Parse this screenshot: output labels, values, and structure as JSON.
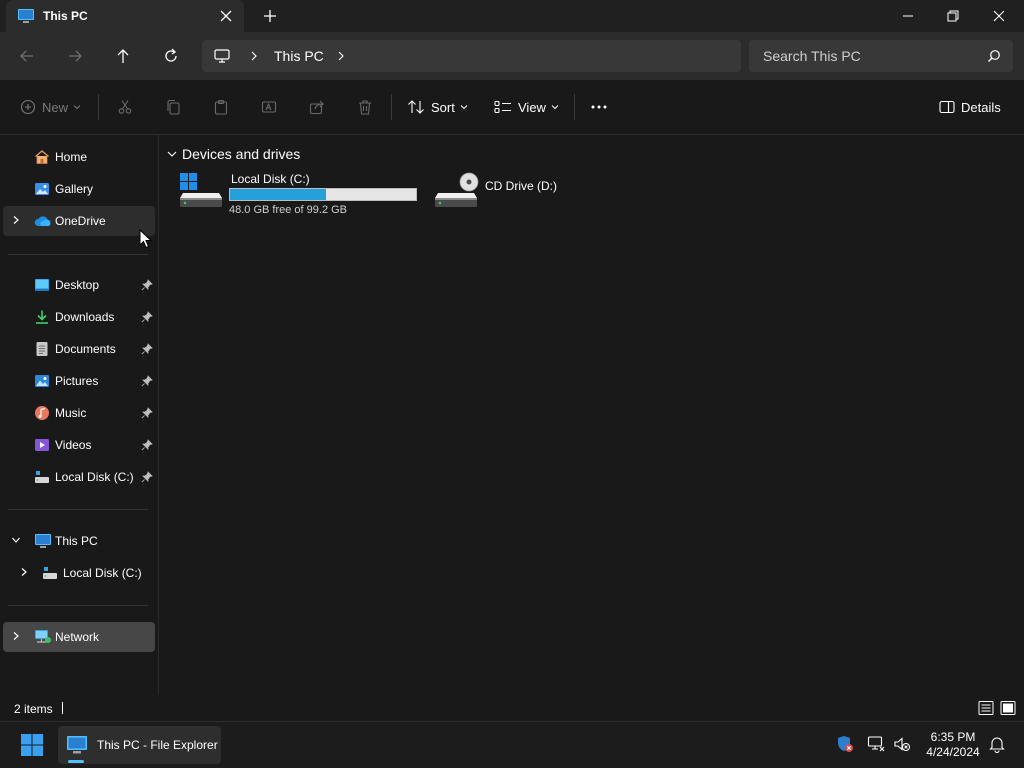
{
  "window": {
    "tab_title": "This PC",
    "icons": {
      "tab": "this-pc-icon",
      "close_tab": "close-icon",
      "new_tab": "plus-icon",
      "minimize": "minimize-icon",
      "maximize": "restore-icon",
      "close": "close-icon"
    }
  },
  "address_bar": {
    "breadcrumbs": [
      "This PC"
    ],
    "icons": {
      "root": "monitor-icon",
      "separator": "chevron-right-icon"
    },
    "nav": {
      "back": "arrow-left-icon",
      "forward": "arrow-right-icon",
      "up": "arrow-up-icon",
      "refresh": "refresh-icon"
    }
  },
  "search": {
    "placeholder": "Search This PC",
    "value": "",
    "icon": "search-icon"
  },
  "command_bar": {
    "new_label": "New",
    "sort_label": "Sort",
    "view_label": "View",
    "details_label": "Details",
    "disabled_actions": [
      "cut-icon",
      "copy-icon",
      "paste-icon",
      "rename-icon",
      "share-icon",
      "delete-icon"
    ],
    "more_icon": "more-icon"
  },
  "sidebar": {
    "quick": [
      {
        "label": "Home",
        "icon": "home-icon"
      },
      {
        "label": "Gallery",
        "icon": "gallery-icon"
      },
      {
        "label": "OneDrive",
        "icon": "onedrive-icon",
        "expandable": true,
        "state": "hover"
      }
    ],
    "pinned": [
      {
        "label": "Desktop",
        "icon": "desktop-icon"
      },
      {
        "label": "Downloads",
        "icon": "downloads-icon"
      },
      {
        "label": "Documents",
        "icon": "documents-icon"
      },
      {
        "label": "Pictures",
        "icon": "pictures-icon"
      },
      {
        "label": "Music",
        "icon": "music-icon"
      },
      {
        "label": "Videos",
        "icon": "videos-icon"
      },
      {
        "label": "Local Disk (C:)",
        "icon": "drive-icon"
      }
    ],
    "this_pc": {
      "label": "This PC",
      "icon": "this-pc-icon",
      "expanded": true
    },
    "this_pc_children": [
      {
        "label": "Local Disk (C:)",
        "icon": "drive-icon"
      }
    ],
    "network": {
      "label": "Network",
      "icon": "network-icon",
      "state": "selected"
    }
  },
  "content": {
    "group_title": "Devices and drives",
    "drives": [
      {
        "name": "Local Disk (C:)",
        "free_text": "48.0 GB free of 99.2 GB",
        "used_fraction": 0.516,
        "icon": "windows-drive-icon"
      },
      {
        "name": "CD Drive (D:)",
        "icon": "cd-drive-icon"
      }
    ]
  },
  "status_bar": {
    "item_count": "2 items"
  },
  "taskbar": {
    "app_label": "This PC - File Explorer",
    "time": "6:35 PM",
    "date": "4/24/2024",
    "tray_icons": [
      "security-warning-icon",
      "network-disconnected-icon",
      "volume-muted-icon",
      "notification-bell-icon"
    ]
  },
  "colors": {
    "accent": "#26a0da",
    "taskbar_indicator": "#4cc2ff",
    "background": "#191919",
    "selected": "#474747"
  }
}
